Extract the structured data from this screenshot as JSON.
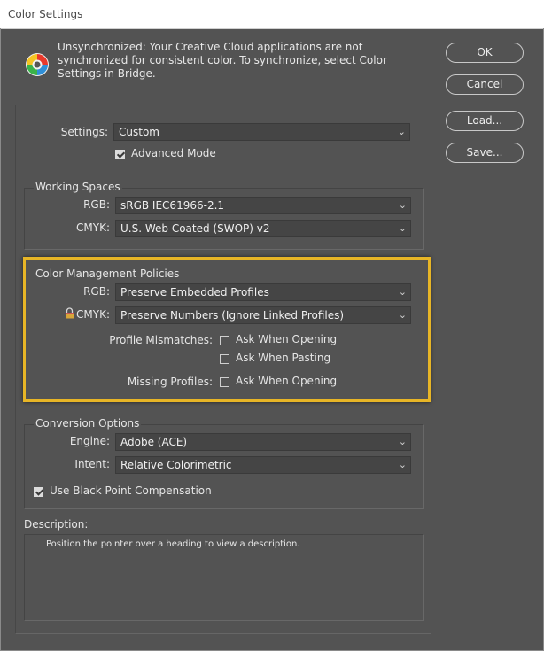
{
  "window": {
    "title": "Color Settings"
  },
  "sync_message": "Unsynchronized: Your Creative Cloud applications are not synchronized for consistent color. To synchronize, select Color Settings in Bridge.",
  "buttons": {
    "ok": "OK",
    "cancel": "Cancel",
    "load": "Load...",
    "save": "Save..."
  },
  "settings": {
    "label": "Settings:",
    "value": "Custom",
    "advanced_mode": "Advanced Mode",
    "advanced_checked": true
  },
  "working_spaces": {
    "title": "Working Spaces",
    "rgb_label": "RGB:",
    "rgb_value": "sRGB IEC61966-2.1",
    "cmyk_label": "CMYK:",
    "cmyk_value": "U.S. Web Coated (SWOP) v2"
  },
  "policies": {
    "title": "Color Management Policies",
    "rgb_label": "RGB:",
    "rgb_value": "Preserve Embedded Profiles",
    "cmyk_label": "CMYK:",
    "cmyk_value": "Preserve Numbers (Ignore Linked Profiles)",
    "mismatch_label": "Profile Mismatches:",
    "ask_opening": "Ask When Opening",
    "ask_pasting": "Ask When Pasting",
    "missing_label": "Missing Profiles:",
    "missing_ask_opening": "Ask When Opening"
  },
  "conversion": {
    "title": "Conversion Options",
    "engine_label": "Engine:",
    "engine_value": "Adobe (ACE)",
    "intent_label": "Intent:",
    "intent_value": "Relative Colorimetric",
    "black_point": "Use Black Point Compensation",
    "black_point_checked": true
  },
  "description": {
    "label": "Description:",
    "text": "Position the pointer over a heading to view a description."
  },
  "icons": {
    "dropdown": "chevron-down-icon",
    "lock": "lock-icon",
    "logo": "color-settings-logo"
  },
  "colors": {
    "highlight": "#e7b526",
    "background": "#535353"
  }
}
